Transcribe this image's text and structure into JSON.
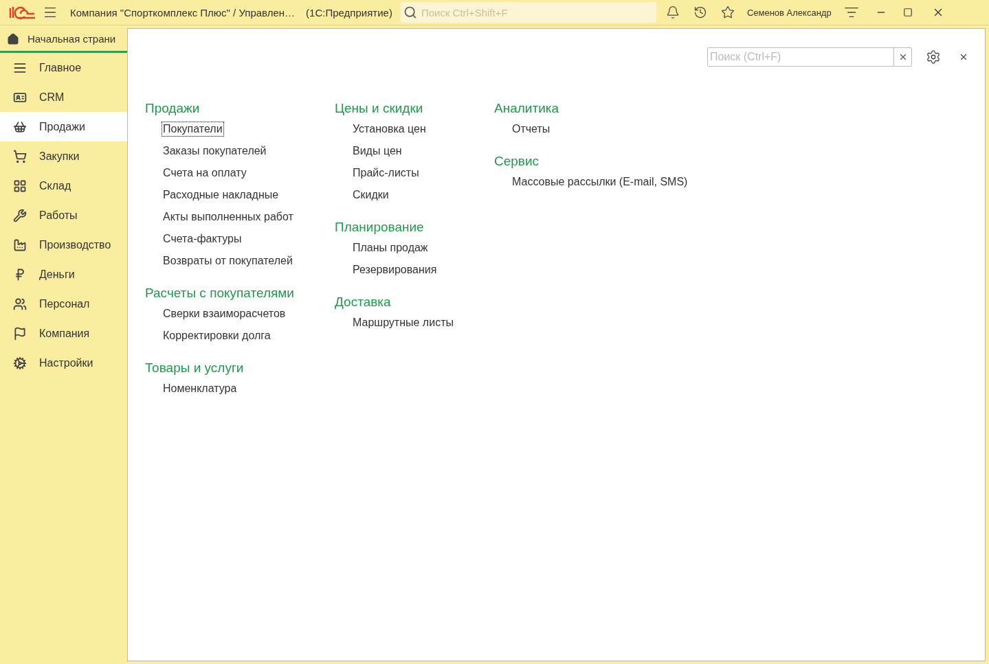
{
  "window": {
    "title": "Компания \"Спорткомплекс Плюс\" / Управлен…",
    "app_name": "(1С:Предприятие)",
    "search": {
      "placeholder": "Поиск Ctrl+Shift+F"
    },
    "user": "Семенов Александр"
  },
  "home_tab": {
    "label": "Начальная страни",
    "selected": true
  },
  "sidebar": {
    "items": [
      {
        "label": "Главное",
        "selected": false
      },
      {
        "label": "CRM",
        "selected": false
      },
      {
        "label": "Продажи",
        "selected": true
      },
      {
        "label": "Закупки",
        "selected": false
      },
      {
        "label": "Склад",
        "selected": false
      },
      {
        "label": "Работы",
        "selected": false
      },
      {
        "label": "Производство",
        "selected": false
      },
      {
        "label": "Деньги",
        "selected": false
      },
      {
        "label": "Персонал",
        "selected": false
      },
      {
        "label": "Компания",
        "selected": false
      },
      {
        "label": "Настройки",
        "selected": false
      }
    ]
  },
  "panel": {
    "search": {
      "placeholder": "Поиск (Ctrl+F)"
    },
    "columns": [
      [
        {
          "title": "Продажи",
          "items": [
            {
              "label": "Покупатели",
              "focused": true
            },
            {
              "label": "Заказы покупателей",
              "focused": false
            },
            {
              "label": "Счета на оплату",
              "focused": false
            },
            {
              "label": "Расходные накладные",
              "focused": false
            },
            {
              "label": "Акты выполненных работ",
              "focused": false
            },
            {
              "label": "Счета-фактуры",
              "focused": false
            },
            {
              "label": "Возвраты от покупателей",
              "focused": false
            }
          ]
        },
        {
          "title": "Расчеты с покупателями",
          "items": [
            {
              "label": "Сверки взаиморасчетов",
              "focused": false
            },
            {
              "label": "Корректировки долга",
              "focused": false
            }
          ]
        },
        {
          "title": "Товары и услуги",
          "items": [
            {
              "label": "Номенклатура",
              "focused": false
            }
          ]
        }
      ],
      [
        {
          "title": "Цены и скидки",
          "items": [
            {
              "label": "Установка цен",
              "focused": false
            },
            {
              "label": "Виды цен",
              "focused": false
            },
            {
              "label": "Прайс-листы",
              "focused": false
            },
            {
              "label": "Скидки",
              "focused": false
            }
          ]
        },
        {
          "title": "Планирование",
          "items": [
            {
              "label": "Планы продаж",
              "focused": false
            },
            {
              "label": "Резервирования",
              "focused": false
            }
          ]
        },
        {
          "title": "Доставка",
          "items": [
            {
              "label": "Маршрутные листы",
              "focused": false
            }
          ]
        }
      ],
      [
        {
          "title": "Аналитика",
          "items": [
            {
              "label": "Отчеты",
              "focused": false
            }
          ]
        },
        {
          "title": "Сервис",
          "items": [
            {
              "label": "Массовые рассылки (E-mail, SMS)",
              "focused": false
            }
          ]
        }
      ]
    ]
  }
}
